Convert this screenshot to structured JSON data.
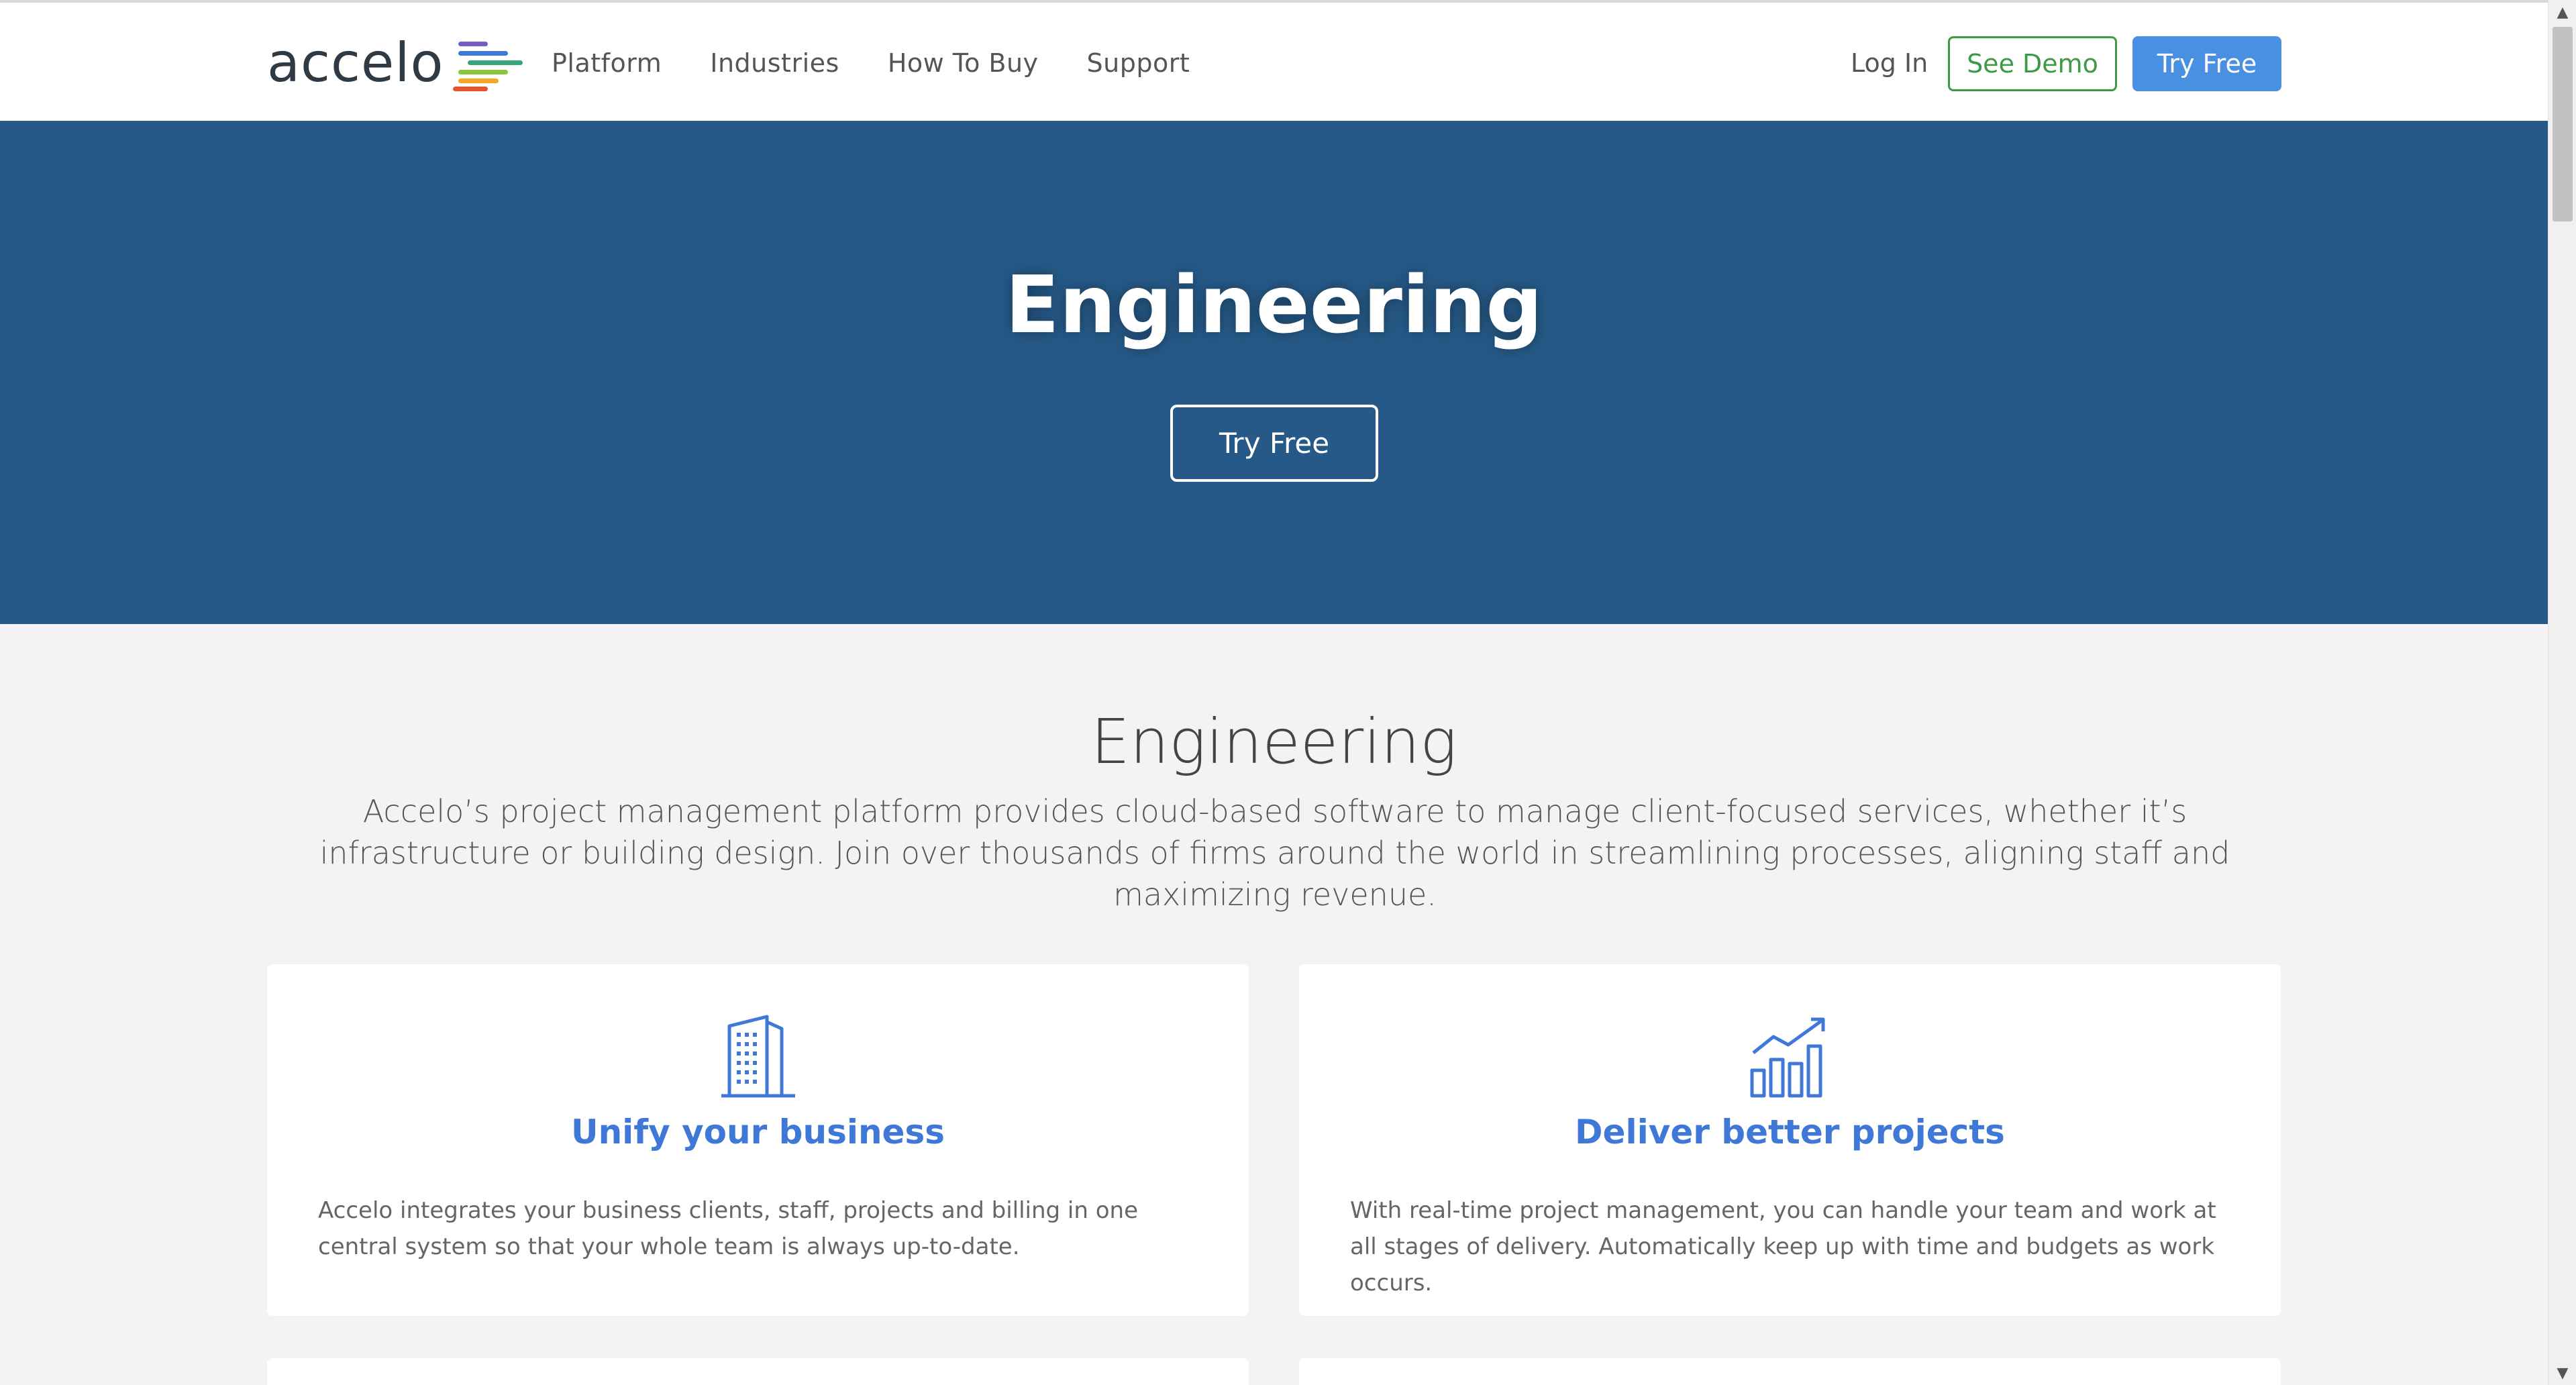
{
  "header": {
    "logo_text": "accelo",
    "logo_colors": [
      "#7b5cc2",
      "#3f78d6",
      "#3aa57a",
      "#8cc63f",
      "#f5a623",
      "#e8532b"
    ],
    "nav": [
      {
        "label": "Platform"
      },
      {
        "label": "Industries"
      },
      {
        "label": "How To Buy"
      },
      {
        "label": "Support"
      }
    ],
    "login_label": "Log In",
    "demo_label": "See Demo",
    "try_free_label": "Try Free"
  },
  "hero": {
    "title": "Engineering",
    "button_label": "Try Free",
    "background_color": "#265987"
  },
  "intro": {
    "title": "Engineering",
    "description": "Accelo’s project management platform provides cloud-based software to manage client-focused services, whether it’s infrastructure or building design. Join over thousands of firms around the world in streamlining processes, aligning staff and maximizing revenue."
  },
  "cards": [
    {
      "icon": "building-icon",
      "title": "Unify your business",
      "text": "Accelo integrates your business clients, staff, projects and billing in one central system so that your whole team is always up-to-date."
    },
    {
      "icon": "growth-chart-icon",
      "title": "Deliver better projects",
      "text": "With real-time project management, you can handle your team and work at all stages of delivery. Automatically keep up with time and budgets as work occurs."
    }
  ],
  "colors": {
    "accent_blue": "#4a90e2",
    "demo_green": "#3d9a46",
    "card_title_blue": "#3f78d6"
  }
}
